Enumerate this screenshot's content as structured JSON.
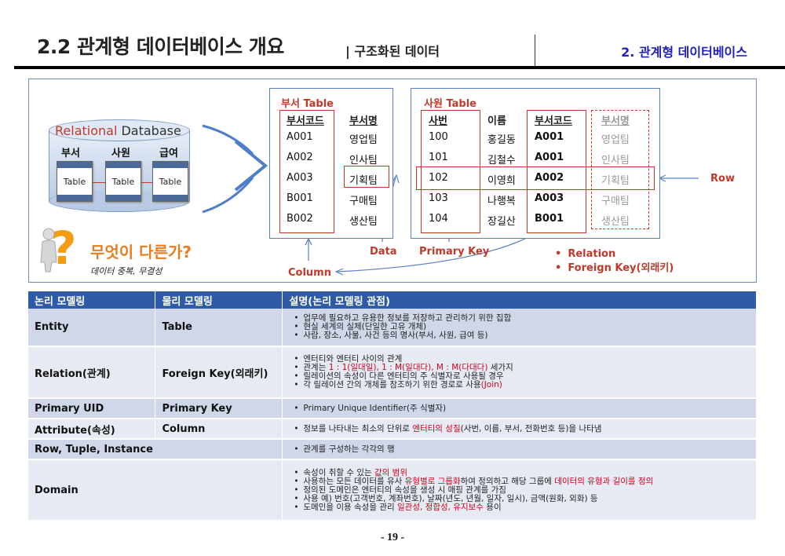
{
  "header": {
    "title": "2.2 관계형 데이터베이스 개요",
    "subtitle": "| 구조화된 데이터",
    "right_title": "2. 관계형 데이터베이스"
  },
  "diagram": {
    "db": {
      "label_relational": "Relational",
      "label_database": " Database",
      "cols": [
        "부서",
        "사원",
        "급여"
      ],
      "box_label": "Table"
    },
    "question": {
      "title": "무엇이 다른가?",
      "subtitle": "데이터 중복, 무결성"
    },
    "dept_table": {
      "caption": "부서 Table",
      "headers": [
        "부서코드",
        "부서명"
      ],
      "rows": [
        [
          "A001",
          "영업팀"
        ],
        [
          "A002",
          "인사팀"
        ],
        [
          "A003",
          "기획팀"
        ],
        [
          "B001",
          "구매팀"
        ],
        [
          "B002",
          "생산팀"
        ]
      ]
    },
    "emp_table": {
      "caption": "사원 Table",
      "headers": [
        "사번",
        "이름",
        "부서코드",
        "부서명"
      ],
      "rows": [
        [
          "100",
          "홍길동",
          "A001",
          "영업팀"
        ],
        [
          "101",
          "김철수",
          "A001",
          "인사팀"
        ],
        [
          "102",
          "이영희",
          "A002",
          "기획팀"
        ],
        [
          "103",
          "나행복",
          "A003",
          "구매팀"
        ],
        [
          "104",
          "장길산",
          "B001",
          "생산팀"
        ]
      ]
    },
    "annotations": {
      "data": "Data",
      "primary_key": "Primary Key",
      "column": "Column",
      "row": "Row",
      "relation": "Relation",
      "foreign_key": "Foreign Key(외래키)"
    }
  },
  "table": {
    "headers": [
      "논리 모델링",
      "물리 모델링",
      "설명(논리 모델링 관점)"
    ],
    "rows": [
      {
        "logical": "Entity",
        "physical": "Table",
        "desc": [
          "업무에 필요하고 유용한 정보를 저장하고 관리하기 위한 집합",
          "현실 세계의 실체(단일한 고유 개체)",
          "사람, 장소, 사물, 사건 등의 명사(부서, 사원, 급여 등)"
        ]
      },
      {
        "logical": "Relation(관계)",
        "physical": "Foreign Key(외래키)",
        "desc_plain": [
          "엔터티와 엔터티 사이의 관계",
          "릴레이션의 속성이 다른 엔터티의 주 식별자로 사용될 경우"
        ],
        "desc_card_pre": "관계는 ",
        "desc_card_red": "1 : 1(일대일), 1 : M(일대다), M : M(다대다)",
        "desc_card_post": " 세가지",
        "desc_join_pre": "각 릴레이션 간의 개체를 참조하기 위한 경로로 사용",
        "desc_join_red": "(Join)"
      },
      {
        "logical": "Primary UID",
        "physical": "Primary Key",
        "desc": [
          "Primary Unique Identifier(주 식별자)"
        ]
      },
      {
        "logical": "Attribute(속성)",
        "physical": "Column",
        "desc_pre": "정보를 나타내는 최소의 단위로 ",
        "desc_red": "엔터티의 성질",
        "desc_post": "(사번, 이름, 부서, 전화번호 등)을 나타냄"
      },
      {
        "logical": "Row, Tuple, Instance",
        "physical": "",
        "desc": [
          "관계를 구성하는 각각의 행"
        ]
      },
      {
        "logical": "Domain",
        "physical": "",
        "d1_pre": "속성이 취할 수 있는 ",
        "d1_red": "값의 범위",
        "d2_pre": "사용하는 모든 데이터를 유사 ",
        "d2_red": "유형별로 그룹화",
        "d2_mid": "하여 정의하고 해당 그룹에 ",
        "d2_red2": "데이터의 유형과 길이를 정의",
        "d3": "정의된 도메인은 엔터티의 속성을 생성 시 매핑 관계를 가짐",
        "d4": "사용 예) 번호(고객번호, 계좌번호), 날짜(년도, 년월, 일자, 일시), 금액(원화, 외화) 등",
        "d5_pre": "도메인을 이용 속성을 관리 ",
        "d5_red": "일관성, 정합성, 유지보수",
        "d5_post": " 용이"
      }
    ]
  },
  "page_number": "- 19 -"
}
